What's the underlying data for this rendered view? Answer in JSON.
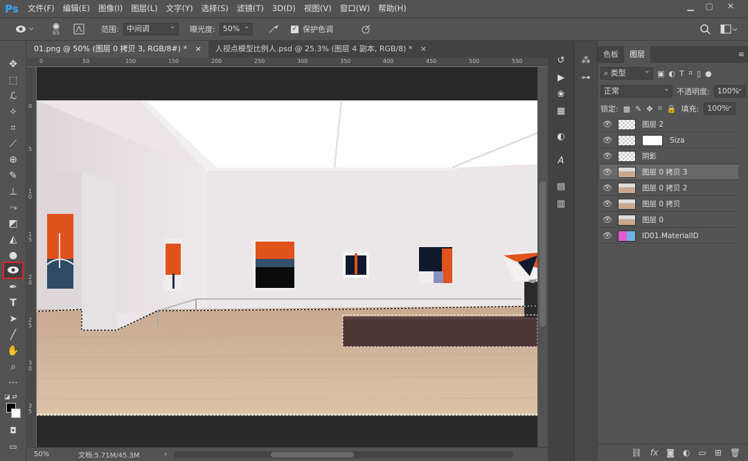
{
  "app": {
    "logo": "Ps"
  },
  "menu": [
    "文件(F)",
    "编辑(E)",
    "图像(I)",
    "图层(L)",
    "文字(Y)",
    "选择(S)",
    "滤镜(T)",
    "3D(D)",
    "视图(V)",
    "窗口(W)",
    "帮助(H)"
  ],
  "window_controls": {
    "minimize": "▁",
    "restore": "▢",
    "close": "✕"
  },
  "options": {
    "brush_size": "65",
    "range_label": "范围:",
    "range_value": "中间调",
    "exposure_label": "曝光度:",
    "exposure_value": "50%",
    "protect_tones_label": "保护色调",
    "protect_tones_checked": true
  },
  "tabs": [
    {
      "label": "01.png @ 50% (图层 0 拷贝 3, RGB/8#) *",
      "close": "×",
      "active": true
    },
    {
      "label": "人视点模型比例人.psd @ 25.3% (图层 4 副本, RGB/8) *",
      "close": "×",
      "active": false
    }
  ],
  "ruler_h_labels": [
    "0",
    "50",
    "100",
    "150",
    "200",
    "250",
    "300",
    "350",
    "400",
    "450",
    "500",
    "550"
  ],
  "ruler_v_labels": [
    "0",
    "5",
    "1 0",
    "1 5",
    "2 0",
    "2 5",
    "3 0",
    "3 5"
  ],
  "status": {
    "zoom": "50%",
    "doc": "文档:5.71M/45.3M",
    "arrow": "›"
  },
  "panel": {
    "tabs": [
      "色板",
      "图层"
    ],
    "filter_kind": "类型",
    "blend_mode": "正常",
    "opacity_label": "不透明度:",
    "opacity_value": "100%",
    "lock_label": "锁定:",
    "fill_label": "填充:",
    "fill_value": "100%",
    "layers": [
      {
        "name": "图层 2",
        "thumb": "checker",
        "selected": false
      },
      {
        "name": "Siza",
        "thumb": "checker",
        "selected": false,
        "mask": true
      },
      {
        "name": "阴影",
        "thumb": "checker",
        "selected": false
      },
      {
        "name": "图层 0 拷贝 3",
        "thumb": "photo",
        "selected": true
      },
      {
        "name": "图层 0 拷贝 2",
        "thumb": "photo",
        "selected": false
      },
      {
        "name": "图层 0 拷贝",
        "thumb": "photo",
        "selected": false
      },
      {
        "name": "图层 0",
        "thumb": "photo",
        "selected": false
      },
      {
        "name": "ID01.MaterialID",
        "thumb": "material",
        "selected": false
      }
    ],
    "bottom_icons": [
      "link-icon",
      "fx-icon",
      "mask-icon",
      "adjustment-icon",
      "group-icon",
      "new-layer-icon",
      "trash-icon"
    ]
  },
  "colors": {
    "foreground": "#000000",
    "background": "#ffffff",
    "accent_highlight": "#e2232a"
  }
}
